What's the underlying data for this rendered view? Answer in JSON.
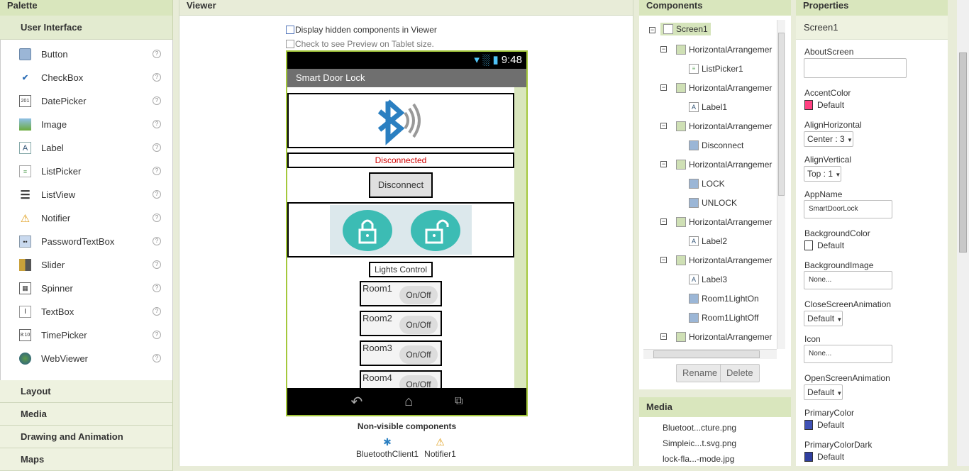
{
  "palette": {
    "title": "Palette",
    "category_open": "User Interface",
    "items": [
      {
        "label": "Button",
        "icon": "button-icon"
      },
      {
        "label": "CheckBox",
        "icon": "checkbox-icon"
      },
      {
        "label": "DatePicker",
        "icon": "datepicker-icon"
      },
      {
        "label": "Image",
        "icon": "image-icon"
      },
      {
        "label": "Label",
        "icon": "label-icon"
      },
      {
        "label": "ListPicker",
        "icon": "listpicker-icon"
      },
      {
        "label": "ListView",
        "icon": "listview-icon"
      },
      {
        "label": "Notifier",
        "icon": "notifier-icon"
      },
      {
        "label": "PasswordTextBox",
        "icon": "password-icon"
      },
      {
        "label": "Slider",
        "icon": "slider-icon"
      },
      {
        "label": "Spinner",
        "icon": "spinner-icon"
      },
      {
        "label": "TextBox",
        "icon": "textbox-icon"
      },
      {
        "label": "TimePicker",
        "icon": "timepicker-icon"
      },
      {
        "label": "WebViewer",
        "icon": "webviewer-icon"
      }
    ],
    "help": "?",
    "categories": [
      "Layout",
      "Media",
      "Drawing and Animation",
      "Maps"
    ]
  },
  "viewer": {
    "title": "Viewer",
    "hidden_checkbox": "Display hidden components in Viewer",
    "tablet_checkbox": "Check to see Preview on Tablet size.",
    "status_time": "9:48",
    "app_title": "Smart Door Lock",
    "status_label": "Disconnected",
    "disconnect_button": "Disconnect",
    "lights_control": "Lights Control",
    "rooms": [
      {
        "label": "Room1",
        "switch": "On/Off"
      },
      {
        "label": "Room2",
        "switch": "On/Off"
      },
      {
        "label": "Room3",
        "switch": "On/Off"
      },
      {
        "label": "Room4",
        "switch": "On/Off"
      }
    ],
    "nonvisible_title": "Non-visible components",
    "nonvisible": [
      "BluetoothClient1",
      "Notifier1"
    ],
    "colors": {
      "status_red": "#d00000",
      "lock_teal": "#3cbcb4",
      "bt_blue": "#2a7fc1"
    }
  },
  "components": {
    "title": "Components",
    "tree": [
      {
        "label": "Screen1",
        "icon": "screen-icon"
      },
      {
        "label": "HorizontalArrangemer",
        "icon": "arrangement-icon"
      },
      {
        "label": "ListPicker1",
        "icon": "listpicker-icon"
      },
      {
        "label": "HorizontalArrangemer",
        "icon": "arrangement-icon"
      },
      {
        "label": "Label1",
        "icon": "label-icon"
      },
      {
        "label": "HorizontalArrangemer",
        "icon": "arrangement-icon"
      },
      {
        "label": "Disconnect",
        "icon": "button-icon"
      },
      {
        "label": "HorizontalArrangemer",
        "icon": "arrangement-icon"
      },
      {
        "label": "LOCK",
        "icon": "button-icon"
      },
      {
        "label": "UNLOCK",
        "icon": "button-icon"
      },
      {
        "label": "HorizontalArrangemer",
        "icon": "arrangement-icon"
      },
      {
        "label": "Label2",
        "icon": "label-icon"
      },
      {
        "label": "HorizontalArrangemer",
        "icon": "arrangement-icon"
      },
      {
        "label": "Label3",
        "icon": "label-icon"
      },
      {
        "label": "Room1LightOn",
        "icon": "button-icon"
      },
      {
        "label": "Room1LightOff",
        "icon": "button-icon"
      },
      {
        "label": "HorizontalArrangemer",
        "icon": "arrangement-icon"
      }
    ],
    "rename": "Rename",
    "delete": "Delete"
  },
  "media": {
    "title": "Media",
    "items": [
      "Bluetoot...cture.png",
      "Simpleic...t.svg.png",
      "lock-fla...-mode.jpg"
    ]
  },
  "properties": {
    "title": "Properties",
    "component": "Screen1",
    "about_label": "AboutScreen",
    "accent_label": "AccentColor",
    "accent_value": "Default",
    "alignh_label": "AlignHorizontal",
    "alignh_value": "Center : 3",
    "alignv_label": "AlignVertical",
    "alignv_value": "Top : 1",
    "appname_label": "AppName",
    "appname_value": "SmartDoorLock",
    "bgcolor_label": "BackgroundColor",
    "bgcolor_value": "Default",
    "bgimage_label": "BackgroundImage",
    "bgimage_value": "None...",
    "closeanim_label": "CloseScreenAnimation",
    "closeanim_value": "Default",
    "icon_label": "Icon",
    "icon_value": "None...",
    "openanim_label": "OpenScreenAnimation",
    "openanim_value": "Default",
    "primary_label": "PrimaryColor",
    "primary_value": "Default",
    "primarydark_label": "PrimaryColorDark",
    "primarydark_value": "Default",
    "colors": {
      "accent": "#ff4081",
      "primary": "#3f51b5",
      "primary_dark": "#303f9f",
      "background": "#ffffff"
    }
  }
}
